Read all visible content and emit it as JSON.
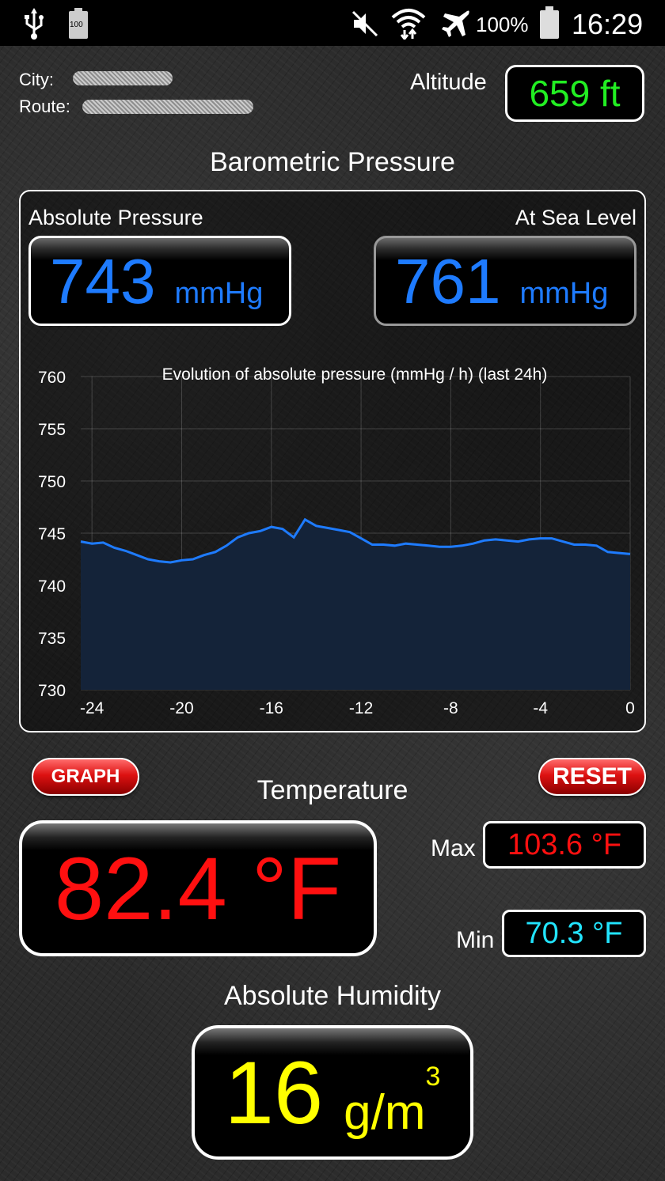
{
  "status_bar": {
    "battery_icon_label": "100",
    "battery_percent": "100%",
    "time": "16:29",
    "icons": [
      "usb-icon",
      "battery-icon",
      "mute-icon",
      "wifi-icon",
      "airplane-icon",
      "battery-full-icon"
    ]
  },
  "location": {
    "city_label": "City:",
    "route_label": "Route:"
  },
  "altitude": {
    "label": "Altitude",
    "value": "659 ft",
    "color": "#22ee22"
  },
  "barometer": {
    "title": "Barometric Pressure",
    "absolute_label": "Absolute Pressure",
    "absolute_value": "743",
    "absolute_unit": "mmHg",
    "sealevel_label": "At Sea Level",
    "sealevel_value": "761",
    "sealevel_unit": "mmHg",
    "color": "#1e7bff"
  },
  "chart_data": {
    "type": "area",
    "title": "Evolution of absolute pressure (mmHg / h) (last 24h)",
    "xlabel": "",
    "ylabel": "",
    "xlim": [
      -24,
      0
    ],
    "ylim": [
      730,
      760
    ],
    "x_ticks": [
      -24,
      -20,
      -16,
      -12,
      -8,
      -4,
      0
    ],
    "y_ticks": [
      760,
      755,
      750,
      745,
      740,
      735,
      730
    ],
    "grid": true,
    "series": [
      {
        "line_color": "#1e7bff",
        "fill_color": "#142339",
        "x": [
          -24.5,
          -24,
          -23.5,
          -23,
          -22.5,
          -22,
          -21.5,
          -21,
          -20.5,
          -20,
          -19.5,
          -19,
          -18.5,
          -18,
          -17.5,
          -17,
          -16.5,
          -16,
          -15.5,
          -15,
          -14.5,
          -14,
          -13.5,
          -13,
          -12.5,
          -12,
          -11.5,
          -11,
          -10.5,
          -10,
          -9.5,
          -9,
          -8.5,
          -8,
          -7.5,
          -7,
          -6.5,
          -6,
          -5.5,
          -5,
          -4.5,
          -4,
          -3.5,
          -3,
          -2.5,
          -2,
          -1.5,
          -1,
          -0.5,
          0
        ],
        "values": [
          744.2,
          744.0,
          744.1,
          743.6,
          743.3,
          742.9,
          742.5,
          742.3,
          742.2,
          742.4,
          742.5,
          742.9,
          743.2,
          743.8,
          744.6,
          745.0,
          745.2,
          745.6,
          745.4,
          744.6,
          746.3,
          745.7,
          745.5,
          745.3,
          745.1,
          744.5,
          743.9,
          743.9,
          743.8,
          744.0,
          743.9,
          743.8,
          743.7,
          743.7,
          743.8,
          744.0,
          744.3,
          744.4,
          744.3,
          744.2,
          744.4,
          744.5,
          744.5,
          744.2,
          743.9,
          743.9,
          743.8,
          743.2,
          743.1,
          743.0
        ]
      }
    ]
  },
  "buttons": {
    "graph": "GRAPH",
    "reset": "RESET"
  },
  "temperature": {
    "title": "Temperature",
    "value": "82.4 °F",
    "color": "#ff1010",
    "max_label": "Max",
    "max_value": "103.6 °F",
    "max_color": "#ff1010",
    "min_label": "Min",
    "min_value": "70.3 °F",
    "min_color": "#22e5ff"
  },
  "humidity": {
    "title": "Absolute Humidity",
    "value": "16",
    "unit": "g/m",
    "unit_superscript": "3",
    "color": "#ffff00"
  }
}
